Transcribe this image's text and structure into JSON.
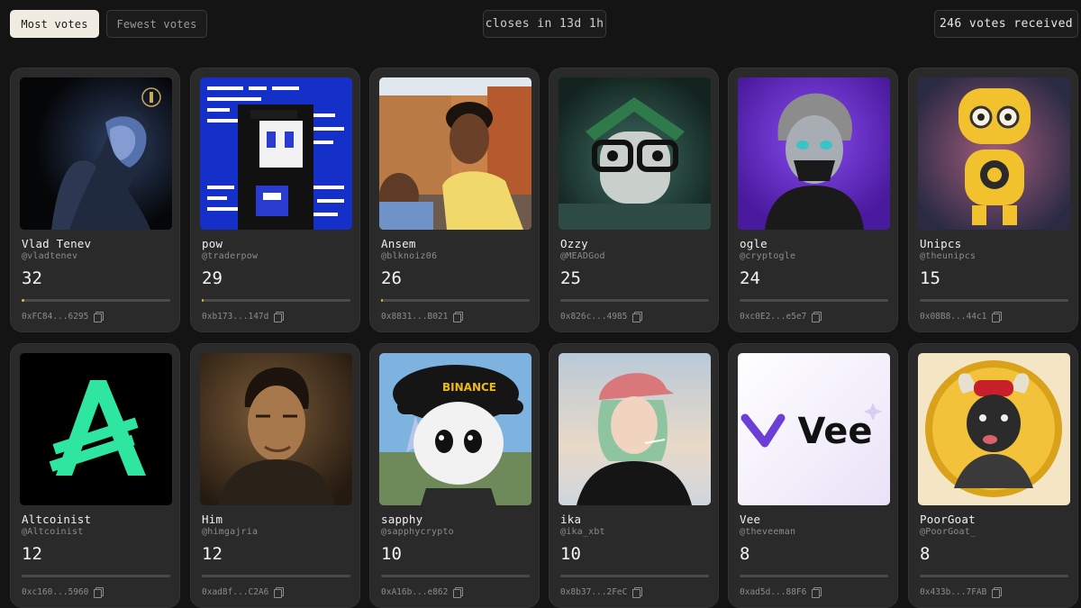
{
  "toolbar": {
    "most_votes": "Most votes",
    "fewest_votes": "Fewest votes",
    "closes": "closes in 13d 1h",
    "votes_received": "246 votes received"
  },
  "cards": [
    {
      "name": "Vlad Tenev",
      "handle": "@vladtenev",
      "votes": "32",
      "address": "0xFC84...6295",
      "image": "vlad-tenev-avatar",
      "vote_share": 0.017
    },
    {
      "name": "pow",
      "handle": "@traderpow",
      "votes": "29",
      "address": "0xb173...147d",
      "image": "pow-avatar",
      "vote_share": 0.013
    },
    {
      "name": "Ansem",
      "handle": "@blknoiz06",
      "votes": "26",
      "address": "0x8831...B021",
      "image": "ansem-avatar",
      "vote_share": 0.012
    },
    {
      "name": "Ozzy",
      "handle": "@MEADGod",
      "votes": "25",
      "address": "0x826c...4985",
      "image": "ozzy-avatar",
      "vote_share": 0
    },
    {
      "name": "ogle",
      "handle": "@cryptogle",
      "votes": "24",
      "address": "0xc0E2...e5e7",
      "image": "ogle-avatar",
      "vote_share": 0
    },
    {
      "name": "Unipcs",
      "handle": "@theunipcs",
      "votes": "15",
      "address": "0x08B8...44c1",
      "image": "unipcs-avatar",
      "vote_share": 0
    },
    {
      "name": "Altcoinist",
      "handle": "@Altcoinist",
      "votes": "12",
      "address": "0xc160...5960",
      "image": "altcoinist-avatar",
      "vote_share": 0
    },
    {
      "name": "Him",
      "handle": "@himgajria",
      "votes": "12",
      "address": "0xad8f...C2A6",
      "image": "him-avatar",
      "vote_share": 0
    },
    {
      "name": "sapphy",
      "handle": "@sapphycrypto",
      "votes": "10",
      "address": "0xA16b...e862",
      "image": "sapphy-avatar",
      "vote_share": 0
    },
    {
      "name": "ika",
      "handle": "@ika_xbt",
      "votes": "10",
      "address": "0x8b37...2FeC",
      "image": "ika-avatar",
      "vote_share": 0
    },
    {
      "name": "Vee",
      "handle": "@theveeman",
      "votes": "8",
      "address": "0xad5d...88F6",
      "image": "vee-avatar",
      "vote_share": 0
    },
    {
      "name": "PoorGoat",
      "handle": "@PoorGoat_",
      "votes": "8",
      "address": "0x433b...7FAB",
      "image": "poorgoat-avatar",
      "vote_share": 0
    }
  ],
  "logos": {
    "binance": "BINANCE",
    "vee": "Vee"
  },
  "colors": {
    "accent": "#e1b34a",
    "active_button": "#f1ece1",
    "card": "#2a2a2a",
    "background": "#141414"
  }
}
